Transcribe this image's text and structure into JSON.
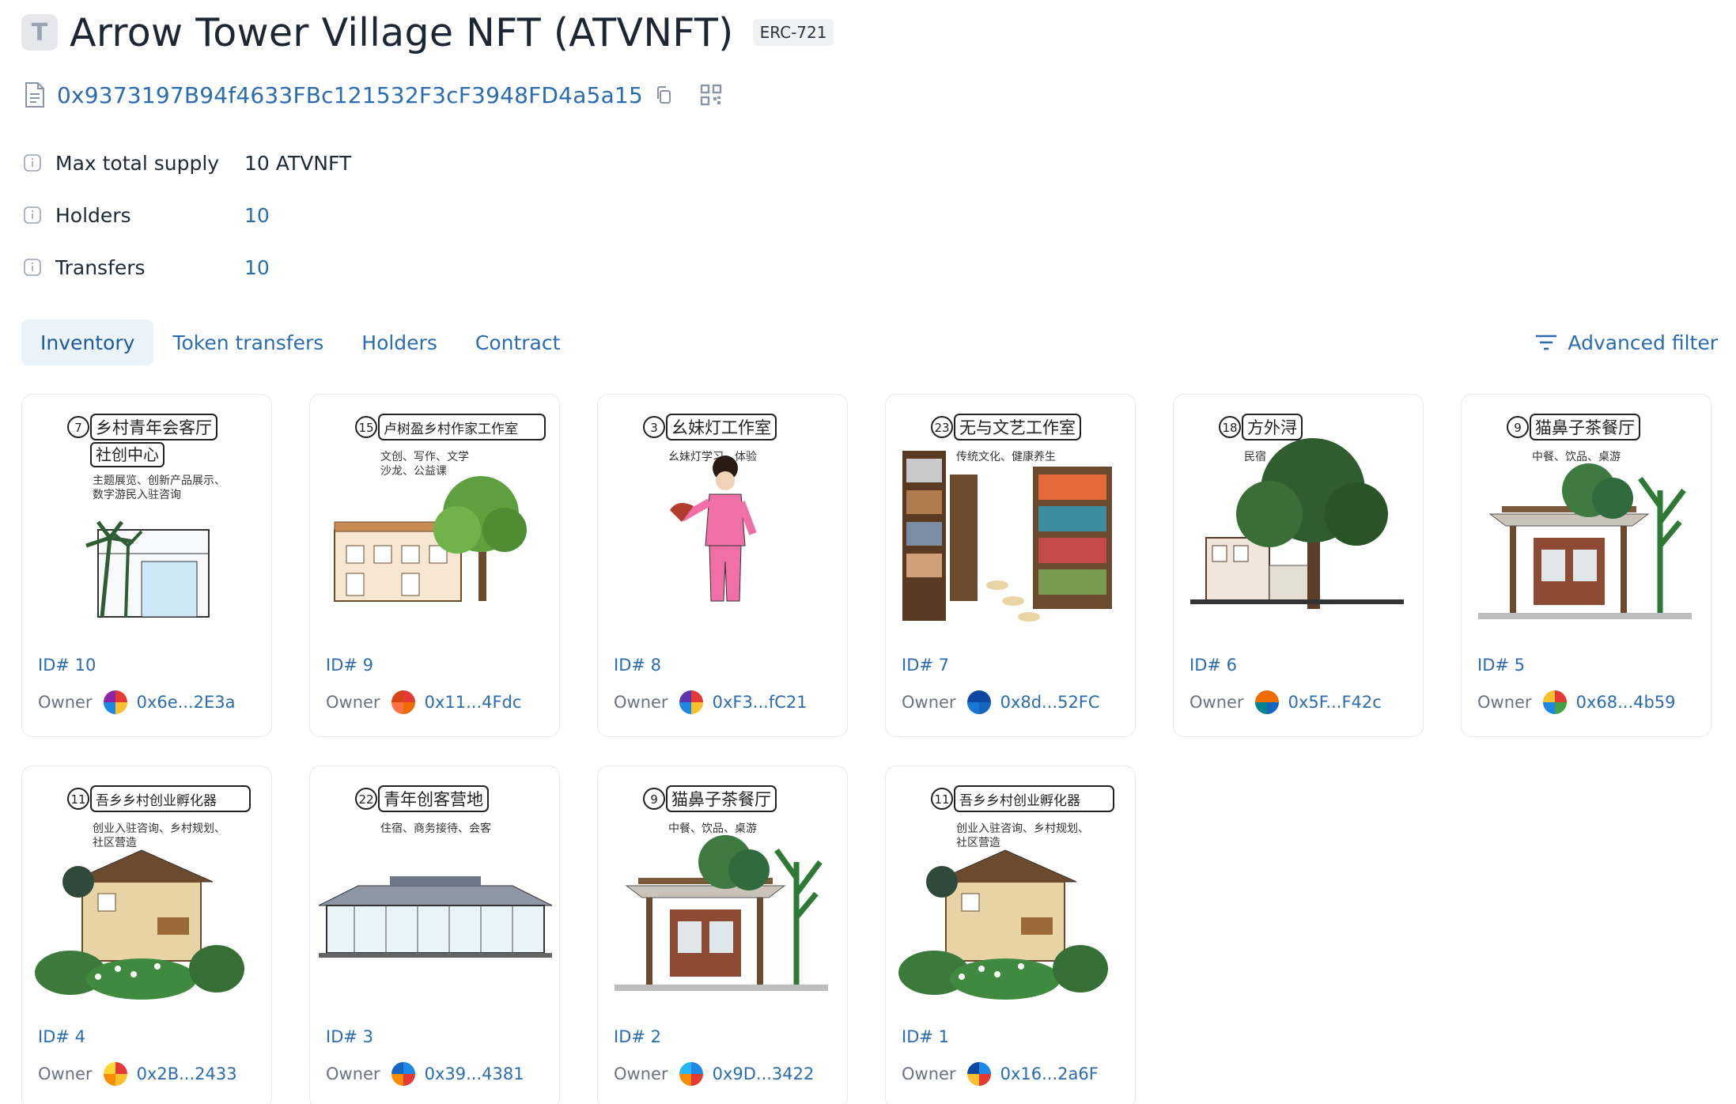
{
  "token": {
    "avatar_letter": "T",
    "title": "Arrow Tower Village NFT (ATVNFT)",
    "standard": "ERC-721",
    "address": "0x9373197B94f4633FBc121532F3cF3948FD4a5a15"
  },
  "props": [
    {
      "label": "Max total supply",
      "value": "10 ATVNFT",
      "link": false
    },
    {
      "label": "Holders",
      "value": "10",
      "link": true
    },
    {
      "label": "Transfers",
      "value": "10",
      "link": true
    }
  ],
  "tabs": [
    "Inventory",
    "Token transfers",
    "Holders",
    "Contract"
  ],
  "active_tab": "Inventory",
  "advanced_filter_label": "Advanced filter",
  "owner_label": "Owner",
  "colors": {
    "link": "#2b6cb0",
    "active_tab_bg": "#ebf3fb",
    "border": "#e6e9ee"
  },
  "cards": [
    {
      "id": "ID# 10",
      "owner": "0x6e...2E3a",
      "num": "7",
      "title": "乡村青年会客厅",
      "title2": "社创中心",
      "subtitle": "主题展览、创新产品展示、",
      "subtitle2": "数字游民入驻咨询",
      "art": "palm-house",
      "avatar": [
        "#e53935",
        "#fbc02d",
        "#1e88e5",
        "#8e24aa"
      ]
    },
    {
      "id": "ID# 9",
      "owner": "0x11...4Fdc",
      "num": "15",
      "title": "卢树盈乡村作家工作室",
      "title2": "",
      "subtitle": "文创、写作、文学",
      "subtitle2": "沙龙、公益课",
      "art": "school-tree",
      "avatar": [
        "#e53935",
        "#ef6c00",
        "#ff7043",
        "#d84315"
      ]
    },
    {
      "id": "ID# 8",
      "owner": "0xF3...fC21",
      "num": "3",
      "title": "幺妹灯工作室",
      "title2": "",
      "subtitle": "幺妹灯学习、体验",
      "subtitle2": "",
      "art": "dancer",
      "avatar": [
        "#e53935",
        "#fbc02d",
        "#1e88e5",
        "#5e35b1"
      ]
    },
    {
      "id": "ID# 7",
      "owner": "0x8d...52FC",
      "num": "23",
      "title": "无与文艺工作室",
      "title2": "",
      "subtitle": "传统文化、健康养生",
      "subtitle2": "",
      "art": "library",
      "avatar": [
        "#0d47a1",
        "#1565c0",
        "#1976d2",
        "#0d47a1"
      ]
    },
    {
      "id": "ID# 6",
      "owner": "0x5F...F42c",
      "num": "18",
      "title": "方外浔",
      "title2": "",
      "subtitle": "民宿",
      "subtitle2": "",
      "art": "big-tree",
      "avatar": [
        "#ef6c00",
        "#1565c0",
        "#00838f",
        "#ef6c00"
      ]
    },
    {
      "id": "ID# 5",
      "owner": "0x68...4b59",
      "num": "9",
      "title": "猫鼻子茶餐厅",
      "title2": "",
      "subtitle": "中餐、饮品、桌游",
      "subtitle2": "",
      "art": "pergola",
      "avatar": [
        "#e53935",
        "#43a047",
        "#1e88e5",
        "#fbc02d"
      ]
    },
    {
      "id": "ID# 4",
      "owner": "0x2B...2433",
      "num": "11",
      "title": "吾乡乡村创业孵化器",
      "title2": "",
      "subtitle": "创业入驻咨询、乡村规划、",
      "subtitle2": "社区营造",
      "art": "cabin",
      "avatar": [
        "#e53935",
        "#fbc02d",
        "#fb8c00",
        "#fdd835"
      ]
    },
    {
      "id": "ID# 3",
      "owner": "0x39...4381",
      "num": "22",
      "title": "青年创客营地",
      "title2": "",
      "subtitle": "住宿、商务接待、会客",
      "subtitle2": "",
      "art": "pavilion",
      "avatar": [
        "#1e88e5",
        "#e53935",
        "#fb8c00",
        "#1565c0"
      ]
    },
    {
      "id": "ID# 2",
      "owner": "0x9D...3422",
      "num": "9",
      "title": "猫鼻子茶餐厅",
      "title2": "",
      "subtitle": "中餐、饮品、桌游",
      "subtitle2": "",
      "art": "pergola",
      "avatar": [
        "#1e88e5",
        "#e53935",
        "#fb8c00",
        "#29b6f6"
      ]
    },
    {
      "id": "ID# 1",
      "owner": "0x16...2a6F",
      "num": "11",
      "title": "吾乡乡村创业孵化器",
      "title2": "",
      "subtitle": "创业入驻咨询、乡村规划、",
      "subtitle2": "社区营造",
      "art": "cabin",
      "avatar": [
        "#1e88e5",
        "#e53935",
        "#fbc02d",
        "#0d47a1"
      ]
    }
  ]
}
